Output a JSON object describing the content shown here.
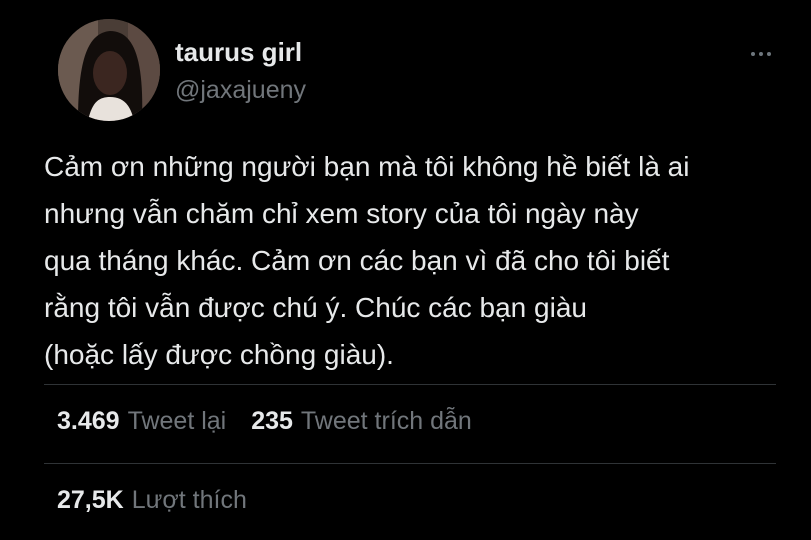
{
  "author": {
    "display_name": "taurus girl",
    "handle": "@jaxajueny"
  },
  "tweet": {
    "lines": [
      "Cảm ơn những người bạn mà tôi không hề biết là ai",
      "nhưng vẫn chăm chỉ xem story của tôi ngày này",
      "qua tháng khác. Cảm ơn các bạn vì đã cho tôi biết",
      "rằng tôi vẫn được chú ý. Chúc các bạn giàu",
      "(hoặc lấy được chồng giàu)."
    ]
  },
  "stats": {
    "retweets": {
      "count": "3.469",
      "label": "Tweet lại"
    },
    "quotes": {
      "count": "235",
      "label": "Tweet trích dẫn"
    },
    "likes": {
      "count": "27,5K",
      "label": "Lượt thích"
    }
  },
  "icons": {
    "more": "more-horizontal-icon"
  },
  "colors": {
    "background": "#000000",
    "primary_text": "#e7e9ea",
    "secondary_text": "#71767b",
    "divider": "#2f3336"
  }
}
